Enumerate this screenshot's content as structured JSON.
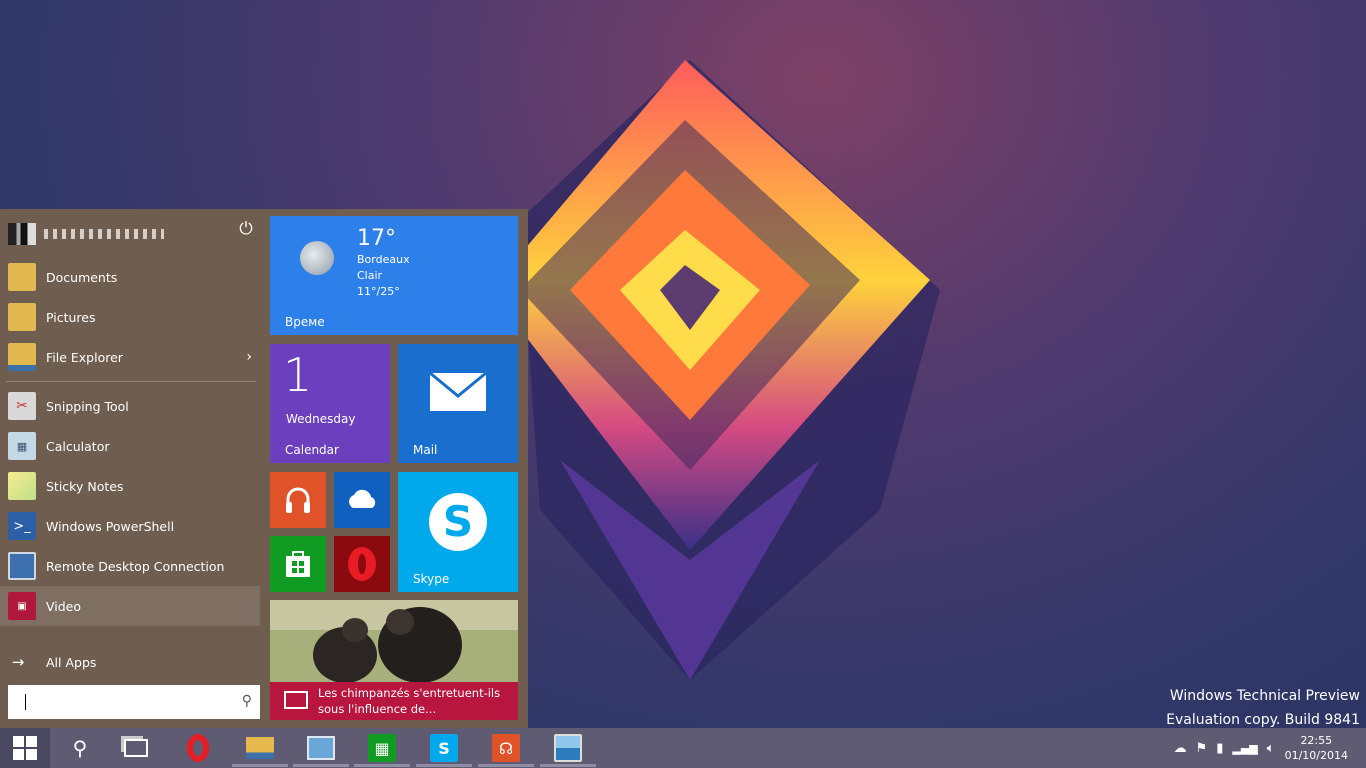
{
  "desktop": {
    "watermark_line1": "Windows Technical Preview",
    "watermark_line2": "Evaluation copy. Build 9841"
  },
  "start_menu": {
    "power_icon": "power-icon",
    "items": [
      {
        "label": "Documents",
        "icon": "folder-icon",
        "color": "#e0b84f"
      },
      {
        "label": "Pictures",
        "icon": "folder-icon",
        "color": "#e0b84f"
      },
      {
        "label": "File Explorer",
        "icon": "folder-icon",
        "color": "#e0b84f",
        "has_submenu": true
      },
      {
        "label": "Snipping Tool",
        "icon": "scissors-icon",
        "color": "#d9d9d9"
      },
      {
        "label": "Calculator",
        "icon": "calculator-icon",
        "color": "#c4d8e6"
      },
      {
        "label": "Sticky Notes",
        "icon": "sticky-notes-icon",
        "color": "#f2e28a"
      },
      {
        "label": "Windows PowerShell",
        "icon": "powershell-icon",
        "color": "#2b5fa6"
      },
      {
        "label": "Remote Desktop Connection",
        "icon": "remote-desktop-icon",
        "color": "#3c6fae"
      },
      {
        "label": "Video",
        "icon": "video-icon",
        "color": "#b0173d",
        "selected": true
      }
    ],
    "all_apps": "All Apps",
    "search_placeholder": ""
  },
  "tiles": {
    "weather": {
      "temp": "17°",
      "city": "Bordeaux",
      "condition": "Clair",
      "range": "11°/25°",
      "label": "Време",
      "color": "#2d7fea"
    },
    "calendar": {
      "day": "1",
      "weekday": "Wednesday",
      "label": "Calendar",
      "color": "#6c3fbf"
    },
    "mail": {
      "label": "Mail",
      "color": "#1a6fce"
    },
    "music": {
      "color": "#e05328"
    },
    "onedrive": {
      "color": "#1060c0"
    },
    "store": {
      "color": "#109c22"
    },
    "opera": {
      "color": "#8b0a0e"
    },
    "skype": {
      "label": "Skype",
      "color": "#00a9ec"
    },
    "news": {
      "headline": "Les chimpanzés s'entretuent-ils sous l'influence de...",
      "color": "#b8153f"
    }
  },
  "taskbar": {
    "time": "22:55",
    "date": "01/10/2014",
    "buttons": [
      "start-icon",
      "search-icon",
      "task-view-icon",
      "opera-icon",
      "file-explorer-icon",
      "control-panel-icon",
      "store-icon",
      "skype-icon",
      "music-icon",
      "photos-icon"
    ]
  }
}
